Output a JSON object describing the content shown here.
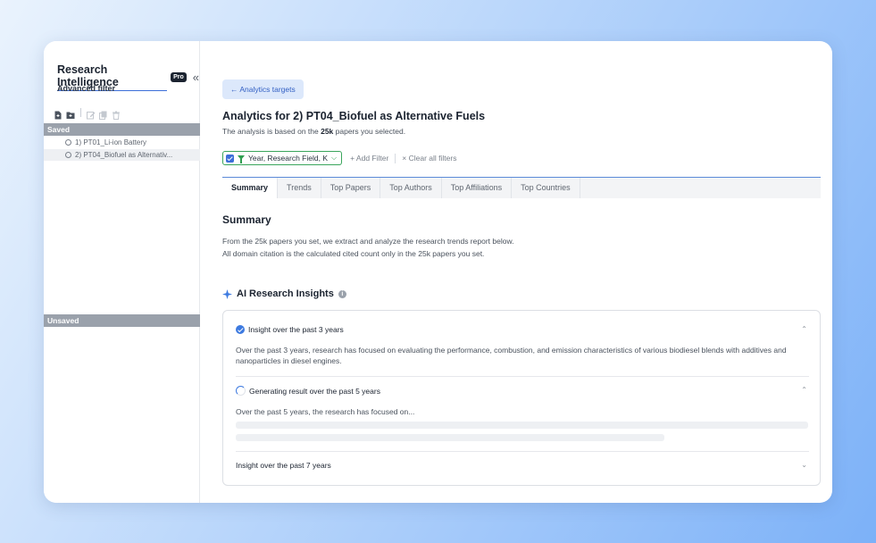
{
  "sidebar": {
    "brand_title": "Research Intelligence",
    "pro_badge": "Pro",
    "collapse_glyph": "«",
    "subtitle": "Advanced filter",
    "toolbar_icons": [
      "new-file-icon",
      "new-folder-icon",
      "edit-icon",
      "copy-icon",
      "trash-icon"
    ],
    "saved_header": "Saved",
    "saved_items": [
      "1) PT01_Li-ion Battery",
      "2) PT04_Biofuel as Alternativ..."
    ],
    "unsaved_header": "Unsaved"
  },
  "main": {
    "back_button": "← Analytics targets",
    "title": "Analytics for 2) PT04_Biofuel as Alternative Fuels",
    "subtitle_pre": "The analysis is based on the ",
    "subtitle_bold": "25k",
    "subtitle_post": " papers you selected.",
    "filter_chip": "Year, Research Field, K",
    "add_filter": "+ Add Filter",
    "clear_filters": "× Clear all filters",
    "tabs": [
      "Summary",
      "Trends",
      "Top Papers",
      "Top Authors",
      "Top Affiliations",
      "Top Countries"
    ],
    "active_tab": "Summary",
    "summary_heading": "Summary",
    "summary_line1": "From the 25k papers you set, we extract and analyze the research trends report below.",
    "summary_line2": "All domain citation is the calculated cited count only in the 25k papers you set.",
    "ai_heading": "AI Research Insights",
    "insights": [
      {
        "title": "Insight over the past 3 years",
        "status": "done",
        "body": "Over the past 3 years, research has focused on evaluating the performance, combustion, and emission characteristics of various biodiesel blends with additives and nanoparticles in diesel engines."
      },
      {
        "title": "Generating result over the past 5 years",
        "status": "loading",
        "body": "Over the past 5 years, the research has focused on..."
      },
      {
        "title": "Insight over the past 7 years",
        "status": "collapsed",
        "body": ""
      }
    ]
  },
  "colors": {
    "accent": "#3d6fd9",
    "filter_green": "#2f9e50",
    "section_header_bg": "#9aa1ab"
  }
}
